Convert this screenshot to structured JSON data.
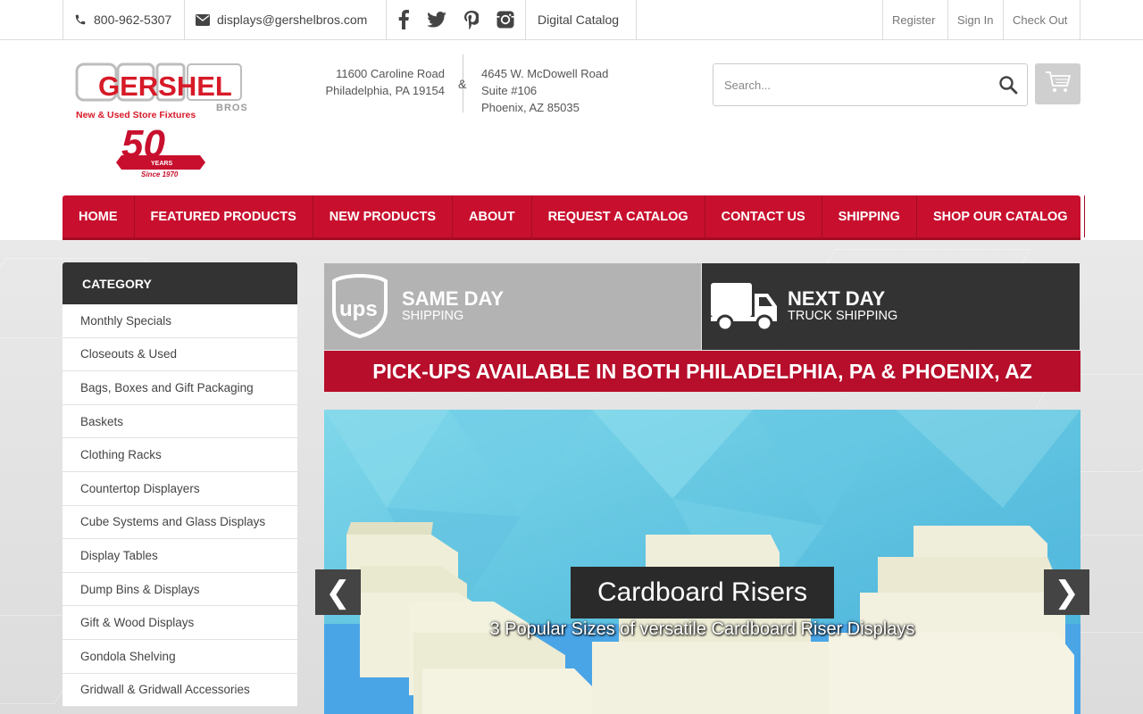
{
  "topbar": {
    "phone": "800-962-5307",
    "email": "displays@gershelbros.com",
    "digital_catalog": "Digital Catalog",
    "register": "Register",
    "sign_in": "Sign In",
    "check_out": "Check Out",
    "social_icons": [
      "facebook-icon",
      "twitter-icon",
      "pinterest-icon",
      "instagram-icon"
    ]
  },
  "header": {
    "logo": {
      "brand": "GERSHEL",
      "bros": "BROS.",
      "tagline": "New & Used Store Fixtures",
      "anniversary": "50",
      "years": "YEARS",
      "since": "Since 1970"
    },
    "address_left": [
      "11600 Caroline Road",
      "Philadelphia, PA 19154"
    ],
    "ampersand": "&",
    "address_right": [
      "4645 W. McDowell Road",
      "Suite #106",
      "Phoenix, AZ 85035"
    ],
    "search_placeholder": "Search..."
  },
  "nav": {
    "items": [
      "HOME",
      "FEATURED PRODUCTS",
      "NEW PRODUCTS",
      "ABOUT",
      "REQUEST A CATALOG",
      "CONTACT US",
      "SHIPPING",
      "SHOP OUR CATALOG"
    ]
  },
  "sidebar": {
    "title": "CATEGORY",
    "items": [
      "Monthly Specials",
      "Closeouts & Used",
      "Bags, Boxes and Gift Packaging",
      "Baskets",
      "Clothing Racks",
      "Countertop Displayers",
      "Cube Systems and Glass Displays",
      "Display Tables",
      "Dump Bins & Displays",
      "Gift & Wood Displays",
      "Gondola Shelving",
      "Gridwall & Gridwall Accessories"
    ]
  },
  "shipping": {
    "left_title": "SAME DAY",
    "left_sub": "SHIPPING",
    "right_title": "NEXT DAY",
    "right_sub": "TRUCK SHIPPING",
    "ups_label": "ups",
    "pickup": "PICK-UPS AVAILABLE IN BOTH PHILADELPHIA, PA & PHOENIX, AZ"
  },
  "slider": {
    "title": "Cardboard Risers",
    "subtitle": "3 Popular Sizes of versatile Cardboard Riser Displays",
    "prev": "❮",
    "next": "❯"
  },
  "colors": {
    "brand_red": "#c8102e",
    "dark": "#333333"
  }
}
